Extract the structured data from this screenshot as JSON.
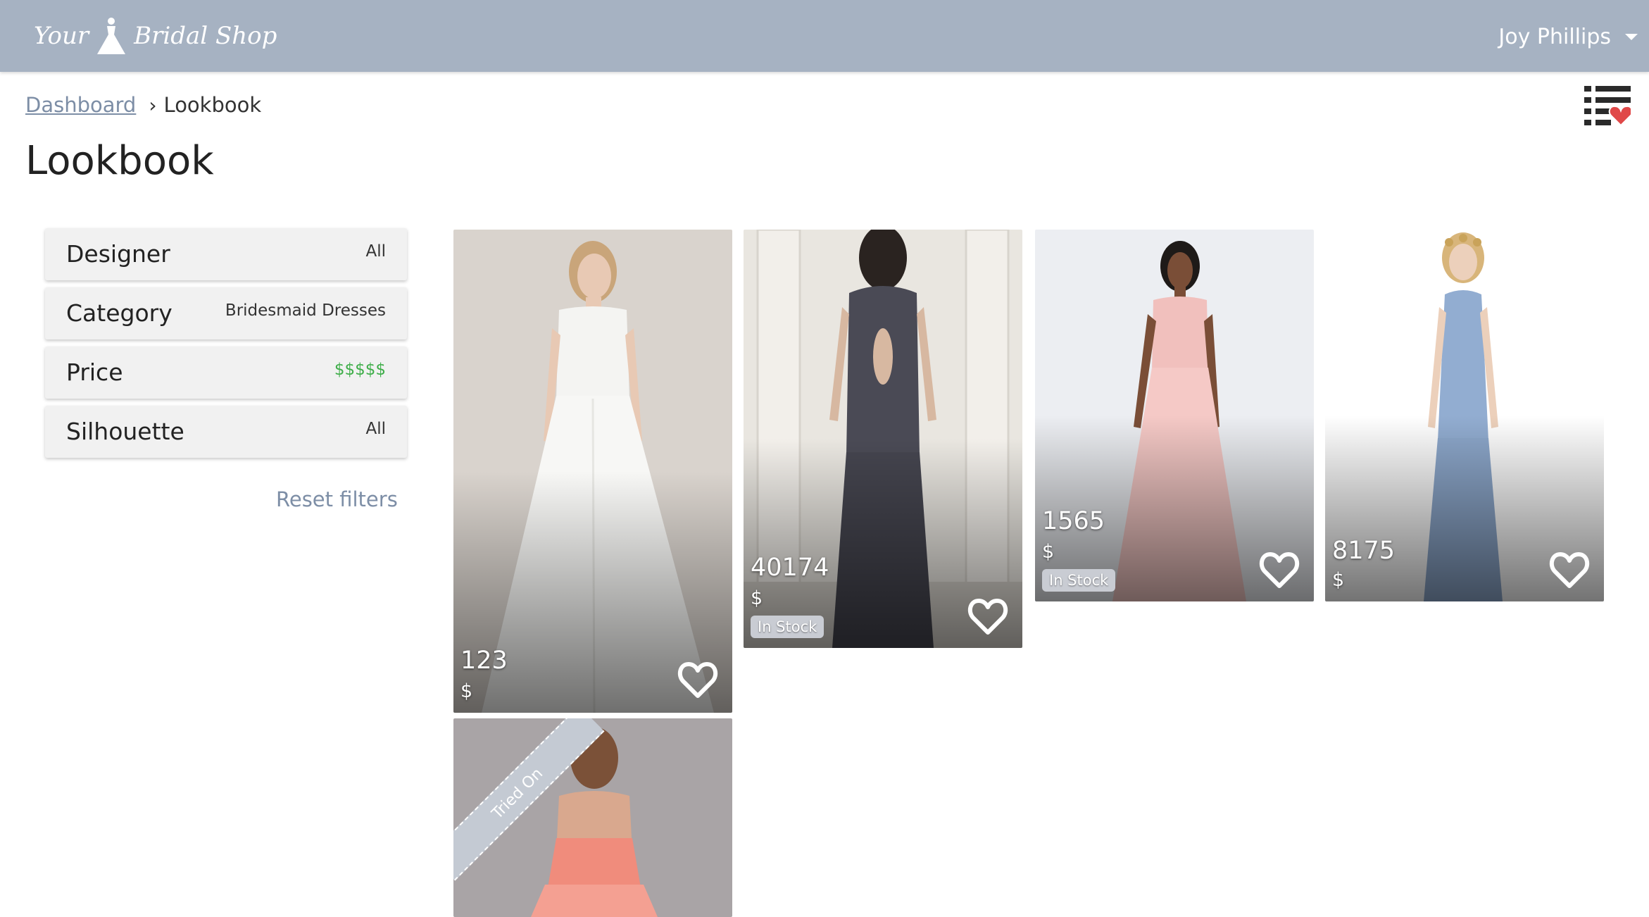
{
  "header": {
    "logo_word1": "Your",
    "logo_word2": "Bridal Shop",
    "user_name": "Joy Phillips"
  },
  "breadcrumb": {
    "dashboard": "Dashboard",
    "separator": "›",
    "current": "Lookbook"
  },
  "page_title": "Lookbook",
  "filters": [
    {
      "label": "Designer",
      "value": "All"
    },
    {
      "label": "Category",
      "value": "Bridesmaid Dresses"
    },
    {
      "label": "Price",
      "value": "$$$$$"
    },
    {
      "label": "Silhouette",
      "value": "All"
    }
  ],
  "reset_label": "Reset filters",
  "cards": [
    {
      "number": "123",
      "price": "$",
      "stock": ""
    },
    {
      "number": "40174",
      "price": "$",
      "stock": "In Stock"
    },
    {
      "number": "1565",
      "price": "$",
      "stock": "In Stock"
    },
    {
      "number": "8175",
      "price": "$",
      "stock": ""
    },
    {
      "number": "",
      "price": "",
      "stock": "",
      "ribbon": "Tried On"
    }
  ],
  "colors": {
    "header_bg": "#a6b2c2",
    "link": "#7d8ea6",
    "price_green": "#3fae4a",
    "favorite_red": "#e04848"
  },
  "icons": {
    "favorites_list": "list-heart-icon",
    "card_favorite": "heart-outline-icon",
    "logo_dress": "dress-icon"
  }
}
